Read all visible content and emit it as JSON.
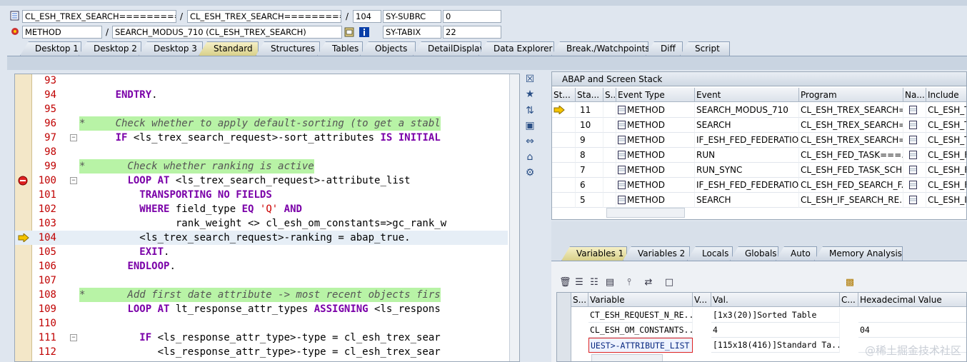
{
  "header": {
    "row1": {
      "class_field": "CL_ESH_TREX_SEARCH===========...",
      "sep1": "/",
      "include_field": "CL_ESH_TREX_SEARCH===========...",
      "sep2": "/",
      "line_field": "104",
      "sysvar_name": "SY-SUBRC",
      "sysvar_value": "0"
    },
    "row2": {
      "type_field": "METHOD",
      "sep": "/",
      "method_field": "SEARCH_MODUS_710 (CL_ESH_TREX_SEARCH)",
      "sysvar_name": "SY-TABIX",
      "sysvar_value": "22"
    }
  },
  "tabs": [
    "Desktop 1",
    "Desktop 2",
    "Desktop 3",
    "Standard",
    "Structures",
    "Tables",
    "Objects",
    "DetailDisplay",
    "Data Explorer",
    "Break./Watchpoints",
    "Diff",
    "Script"
  ],
  "active_tab": "Standard",
  "code": [
    {
      "n": "93",
      "t": ""
    },
    {
      "n": "94",
      "t": "      ENDTRY."
    },
    {
      "n": "95",
      "t": ""
    },
    {
      "n": "96",
      "t": "*     Check whether to apply default-sorting (to get a stabl"
    },
    {
      "n": "97",
      "t": "      IF <ls_trex_search_request>-sort_attributes IS INITIAL"
    },
    {
      "n": "98",
      "t": ""
    },
    {
      "n": "99",
      "t": "*       Check whether ranking is active"
    },
    {
      "n": "100",
      "t": "        LOOP AT <ls_trex_search_request>-attribute_list"
    },
    {
      "n": "101",
      "t": "          TRANSPORTING NO FIELDS"
    },
    {
      "n": "102",
      "t": "          WHERE field_type EQ 'Q' AND"
    },
    {
      "n": "103",
      "t": "                rank_weight <> cl_esh_om_constants=>gc_rank_w"
    },
    {
      "n": "104",
      "t": "          <ls_trex_search_request>-ranking = abap_true."
    },
    {
      "n": "105",
      "t": "          EXIT."
    },
    {
      "n": "106",
      "t": "        ENDLOOP."
    },
    {
      "n": "107",
      "t": ""
    },
    {
      "n": "108",
      "t": "*       Add first date attribute -> most recent objects firs"
    },
    {
      "n": "109",
      "t": "        LOOP AT lt_response_attr_types ASSIGNING <ls_respons"
    },
    {
      "n": "110",
      "t": ""
    },
    {
      "n": "111",
      "t": "          IF <ls_response_attr_type>-type = cl_esh_trex_sear"
    },
    {
      "n": "112",
      "t": "             <ls_response_attr_type>-type = cl_esh_trex_sear"
    }
  ],
  "stack": {
    "title": "ABAP and Screen Stack",
    "columns": [
      "St...",
      "Sta...",
      "S...",
      "Event Type",
      "Event",
      "Program",
      "Na...",
      "Include"
    ],
    "rows": [
      {
        "level": "11",
        "type": "METHOD",
        "event": "SEARCH_MODUS_710",
        "program": "CL_ESH_TREX_SEARCH=...",
        "include": "CL_ESH_T",
        "current": true
      },
      {
        "level": "10",
        "type": "METHOD",
        "event": "SEARCH",
        "program": "CL_ESH_TREX_SEARCH=...",
        "include": "CL_ESH_T",
        "current": false
      },
      {
        "level": "9",
        "type": "METHOD",
        "event": "IF_ESH_FED_FEDERATIO...",
        "program": "CL_ESH_TREX_SEARCH=...",
        "include": "CL_ESH_T",
        "current": false
      },
      {
        "level": "8",
        "type": "METHOD",
        "event": "RUN",
        "program": "CL_ESH_FED_TASK===...",
        "include": "CL_ESH_F",
        "current": false
      },
      {
        "level": "7",
        "type": "METHOD",
        "event": "RUN_SYNC",
        "program": "CL_ESH_FED_TASK_SCH...",
        "include": "CL_ESH_F",
        "current": false
      },
      {
        "level": "6",
        "type": "METHOD",
        "event": "IF_ESH_FED_FEDERATIO...",
        "program": "CL_ESH_FED_SEARCH_F...",
        "include": "CL_ESH_F",
        "current": false
      },
      {
        "level": "5",
        "type": "METHOD",
        "event": "SEARCH",
        "program": "CL_ESH_IF_SEARCH_RE...",
        "include": "CL_ESH_IF",
        "current": false
      }
    ]
  },
  "var_tabs": [
    "Variables 1",
    "Variables 2",
    "Locals",
    "Globals",
    "Auto",
    "Memory Analysis"
  ],
  "active_var_tab": "Variables 1",
  "variables": {
    "columns": [
      "S...",
      "Variable",
      "V...",
      "Val.",
      "C...",
      "Hexadecimal Value"
    ],
    "rows": [
      {
        "name": "CT_ESH_REQUEST_N_RE...",
        "value": "[1x3(20)]Sorted Table",
        "hex": ""
      },
      {
        "name": "CL_ESH_OM_CONSTANTS...",
        "value": "4",
        "hex": "04"
      },
      {
        "name": "UEST>-ATTRIBUTE_LIST",
        "value": "[115x18(416)]Standard Ta...",
        "hex": ""
      }
    ]
  },
  "watermark": "@稀土掘金技术社区"
}
